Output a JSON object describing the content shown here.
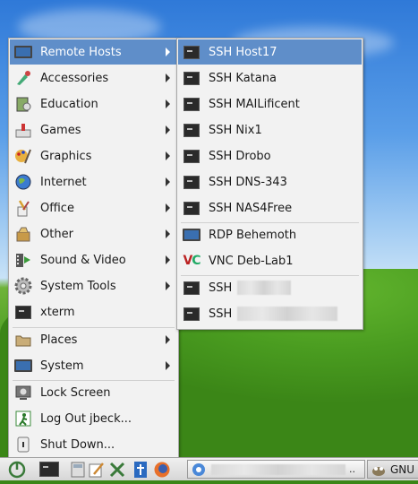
{
  "main_menu": {
    "items": [
      {
        "label": "Remote Hosts",
        "icon": "monitor-icon",
        "submenu": true,
        "active": true
      },
      {
        "label": "Accessories",
        "icon": "accessories-icon",
        "submenu": true
      },
      {
        "label": "Education",
        "icon": "education-icon",
        "submenu": true
      },
      {
        "label": "Games",
        "icon": "games-icon",
        "submenu": true
      },
      {
        "label": "Graphics",
        "icon": "graphics-icon",
        "submenu": true
      },
      {
        "label": "Internet",
        "icon": "globe-icon",
        "submenu": true
      },
      {
        "label": "Office",
        "icon": "office-icon",
        "submenu": true
      },
      {
        "label": "Other",
        "icon": "other-icon",
        "submenu": true
      },
      {
        "label": "Sound & Video",
        "icon": "sound-video-icon",
        "submenu": true
      },
      {
        "label": "System Tools",
        "icon": "gear-icon",
        "submenu": true
      },
      {
        "label": "xterm",
        "icon": "terminal-icon",
        "submenu": false
      },
      {
        "label": "Places",
        "icon": "folder-icon",
        "submenu": true
      },
      {
        "label": "System",
        "icon": "monitor-icon",
        "submenu": true
      },
      {
        "label": "Lock Screen",
        "icon": "lock-icon",
        "submenu": false
      },
      {
        "label": "Log Out jbeck...",
        "icon": "logout-icon",
        "submenu": false
      },
      {
        "label": "Shut Down...",
        "icon": "power-icon",
        "submenu": false
      }
    ]
  },
  "remote_hosts_menu": {
    "items": [
      {
        "label": "SSH Host17",
        "icon": "terminal-icon",
        "active": true
      },
      {
        "label": "SSH Katana",
        "icon": "terminal-icon"
      },
      {
        "label": "SSH MAILificent",
        "icon": "terminal-icon"
      },
      {
        "label": "SSH Nix1",
        "icon": "terminal-icon"
      },
      {
        "label": "SSH Drobo",
        "icon": "terminal-icon"
      },
      {
        "label": "SSH DNS-343",
        "icon": "terminal-icon"
      },
      {
        "label": "SSH NAS4Free",
        "icon": "terminal-icon"
      },
      {
        "label": "RDP Behemoth",
        "icon": "monitor-icon"
      },
      {
        "label": "VNC Deb-Lab1",
        "icon": "vnc-icon"
      },
      {
        "label": "SSH",
        "icon": "terminal-icon",
        "redacted": true
      },
      {
        "label": "SSH",
        "icon": "terminal-icon",
        "redacted": true
      }
    ]
  },
  "taskbar": {
    "window_label": "GNU"
  },
  "colors": {
    "highlight": "#5f8ec9",
    "menu_bg": "#f2f2f2"
  }
}
